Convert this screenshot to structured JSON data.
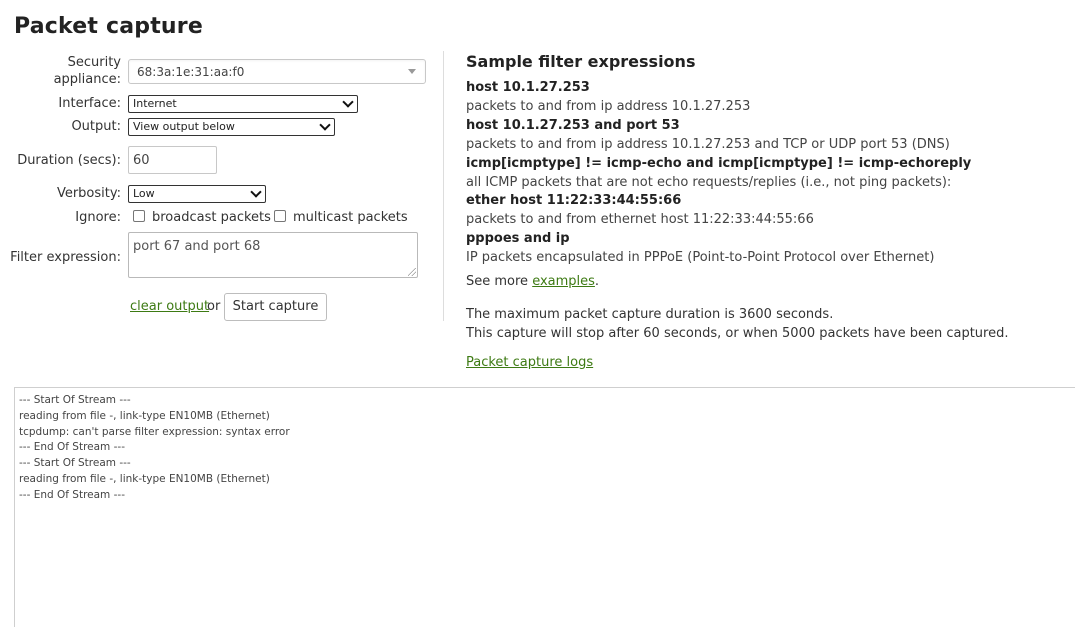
{
  "page_title": "Packet capture",
  "form": {
    "security_label_line1": "Security",
    "security_label_line2": "appliance:",
    "appliance_value": "68:3a:1e:31:aa:f0",
    "interface_label": "Interface:",
    "interface_value": "Internet",
    "output_label": "Output:",
    "output_value": "View output below",
    "duration_label": "Duration (secs):",
    "duration_value": "60",
    "verbosity_label": "Verbosity:",
    "verbosity_value": "Low",
    "ignore_label": "Ignore:",
    "broadcast_label": "broadcast packets",
    "multicast_label": "multicast packets",
    "filter_label": "Filter expression:",
    "filter_value": "port 67 and port 68",
    "clear_output_label": "clear output",
    "or_text": "or",
    "start_capture_label": "Start capture"
  },
  "samples": {
    "heading": "Sample filter expressions",
    "items": [
      {
        "expr": "host 10.1.27.253",
        "desc": "packets to and from ip address 10.1.27.253"
      },
      {
        "expr": "host 10.1.27.253 and port 53",
        "desc": "packets to and from ip address 10.1.27.253 and TCP or UDP port 53 (DNS)"
      },
      {
        "expr": "icmp[icmptype] != icmp-echo and icmp[icmptype] != icmp-echoreply",
        "desc": "all ICMP packets that are not echo requests/replies (i.e., not ping packets):"
      },
      {
        "expr": "ether host 11:22:33:44:55:66",
        "desc": "packets to and from ethernet host 11:22:33:44:55:66"
      },
      {
        "expr": "pppoes and ip",
        "desc": "IP packets encapsulated in PPPoE (Point-to-Point Protocol over Ethernet)"
      }
    ],
    "see_more_prefix": "See more ",
    "see_more_link": "examples",
    "see_more_suffix": ".",
    "max_duration_text": "The maximum packet capture duration is 3600 seconds.",
    "stop_text": "This capture will stop after 60 seconds, or when 5000 packets have been captured.",
    "logs_link": "Packet capture logs"
  },
  "output_lines": [
    "--- Start Of Stream ---",
    "reading from file -, link-type EN10MB (Ethernet)",
    "tcpdump: can't parse filter expression: syntax error",
    "--- End Of Stream ---",
    "--- Start Of Stream ---",
    "reading from file -, link-type EN10MB (Ethernet)",
    "--- End Of Stream ---"
  ],
  "colors": {
    "link": "#3d7a13",
    "text": "#333333"
  }
}
